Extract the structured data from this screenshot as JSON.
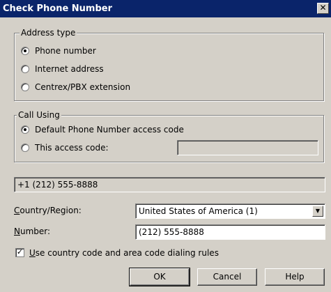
{
  "window": {
    "title": "Check Phone Number",
    "close_glyph": "✕"
  },
  "address_type": {
    "legend": "Address type",
    "options": [
      {
        "label": "Phone number",
        "selected": true
      },
      {
        "label": "Internet address",
        "selected": false
      },
      {
        "label": "Centrex/PBX extension",
        "selected": false
      }
    ]
  },
  "call_using": {
    "legend": "Call Using",
    "options": [
      {
        "label": "Default Phone Number access code",
        "selected": true
      },
      {
        "label": "This access code:",
        "selected": false
      }
    ],
    "access_code_value": ""
  },
  "preview": {
    "value": "+1 (212) 555-8888"
  },
  "country": {
    "label_underlined": "C",
    "label_rest": "ountry/Region:",
    "value": "United States of America (1)",
    "arrow_glyph": "▼"
  },
  "number": {
    "label_underlined": "N",
    "label_rest": "umber:",
    "value": "(212) 555-8888"
  },
  "dialing_rules": {
    "checked": true,
    "check_glyph": "✓",
    "label_underlined": "U",
    "label_rest": "se country code and area code dialing rules"
  },
  "buttons": {
    "ok": "OK",
    "cancel": "Cancel",
    "help": "Help"
  }
}
